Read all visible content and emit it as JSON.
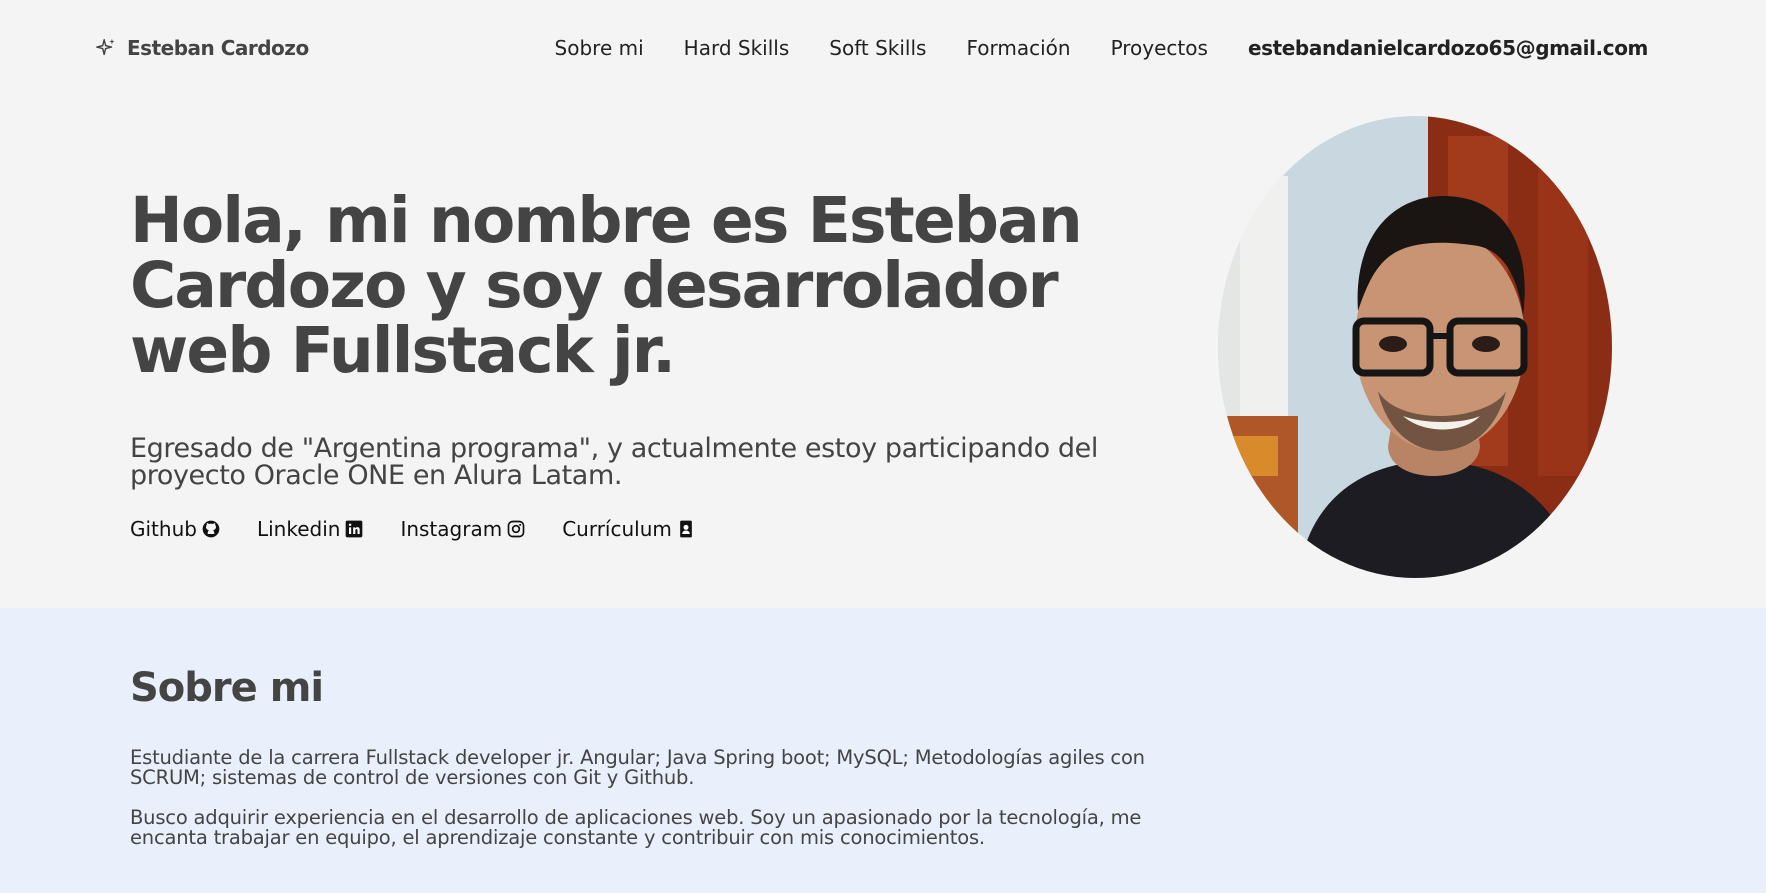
{
  "brand": {
    "icon": "sparkle-icon",
    "name": "Esteban Cardozo"
  },
  "nav": {
    "items": [
      "Sobre mi",
      "Hard Skills",
      "Soft Skills",
      "Formación",
      "Proyectos"
    ],
    "email": "estebandanielcardozo65@gmail.com"
  },
  "hero": {
    "title": "Hola, mi nombre es Esteban Cardozo y soy desarrolador web Fullstack jr.",
    "subtitle": "Egresado de \"Argentina programa\", y actualmente estoy participando del proyecto Oracle ONE en Alura Latam.",
    "links": [
      {
        "label": "Github",
        "icon": "github-icon"
      },
      {
        "label": "Linkedin",
        "icon": "linkedin-icon"
      },
      {
        "label": "Instagram",
        "icon": "instagram-icon"
      },
      {
        "label": "Currículum",
        "icon": "resume-icon"
      }
    ]
  },
  "about": {
    "title": "Sobre mi",
    "paragraphs": [
      "Estudiante de la carrera Fullstack developer jr. Angular; Java Spring boot; MySQL; Metodologías agiles con SCRUM; sistemas de control de versiones con Git y Github.",
      "Busco adquirir experiencia en el desarrollo de aplicaciones web. Soy un apasionado por la tecnología, me encanta trabajar en equipo, el aprendizaje constante y contribuir con mis conocimientos."
    ]
  },
  "colors": {
    "page_bg": "#f4f4f4",
    "about_bg": "#e9f0fc",
    "text": "#444444"
  }
}
